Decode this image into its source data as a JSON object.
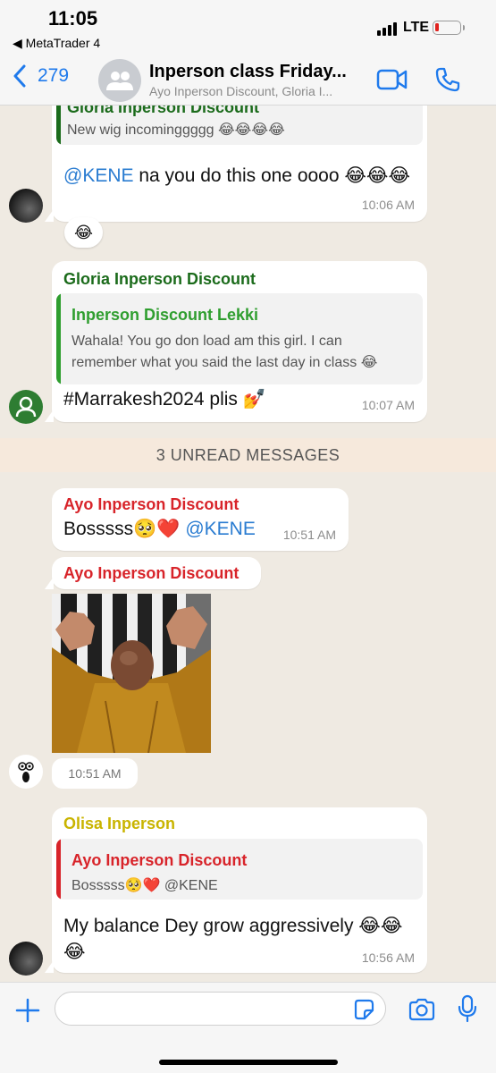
{
  "status_bar": {
    "time": "11:05",
    "back_app": "◀ MetaTrader 4",
    "network": "LTE"
  },
  "header": {
    "back_count": "279",
    "title": "Inperson class Friday...",
    "subtitle": "Ayo Inperson Discount, Gloria I..."
  },
  "messages": {
    "m1": {
      "quote_name": "Gloria Inperson Discount",
      "quote_text": "New wig incominggggg 😂😂😂😂",
      "mention": "@KENE",
      "text": " na you do this one oooo 😂😂😂",
      "time": "10:06 AM",
      "reaction": "😂"
    },
    "m2": {
      "sender": "Gloria Inperson Discount",
      "quote_name": "Inperson Discount Lekki",
      "quote_line1": "Wahala! You go don load am this girl. I can",
      "quote_line2": "remember what you said the last day in class 😂",
      "text": "#Marrakesh2024 plis 💅",
      "time": "10:07 AM"
    },
    "unread_divider": "3 UNREAD MESSAGES",
    "m3": {
      "sender": "Ayo Inperson Discount",
      "text": "Bosssss🥺❤️ ",
      "mention": "@KENE",
      "time": "10:51 AM"
    },
    "m4": {
      "sender": "Ayo Inperson Discount",
      "time": "10:51 AM"
    },
    "m5": {
      "sender": "Olisa Inperson",
      "quote_name": "Ayo Inperson Discount",
      "quote_text": "Bosssss🥺❤️ ",
      "quote_mention": "@KENE",
      "text": "My balance Dey grow aggressively 😂😂😂",
      "time": "10:56 AM"
    }
  },
  "colors": {
    "accent_blue": "#1f7aec",
    "gloria_green": "#1b6b1b",
    "lekki_green": "#2f9e2f",
    "ayo_red": "#d8242a",
    "olisa_yellow": "#c9b400",
    "divider_bg": "#f6e9dc"
  },
  "icons": [
    "back-chevron-icon",
    "group-avatar-icon",
    "video-call-icon",
    "phone-call-icon",
    "plus-icon",
    "sticker-icon",
    "camera-icon",
    "microphone-icon"
  ]
}
